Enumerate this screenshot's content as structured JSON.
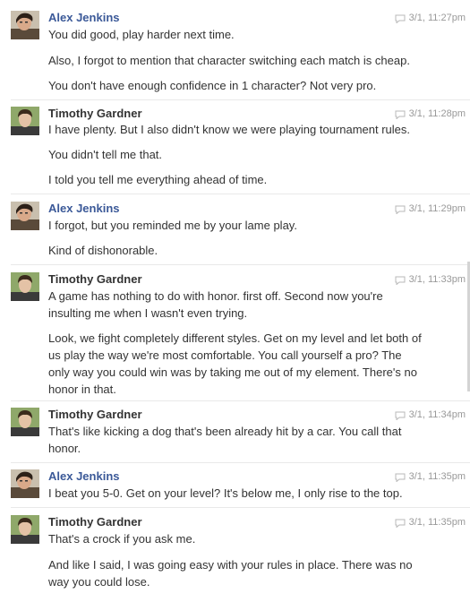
{
  "groups": [
    {
      "author": "Alex Jenkins",
      "time": "3/1, 11:27pm",
      "lines": [
        "You did good, play harder next time.",
        "Also, I forgot to mention that character switching each match is cheap.",
        "You don't have enough confidence in 1 character? Not very pro."
      ]
    },
    {
      "author": "Timothy Gardner",
      "time": "3/1, 11:28pm",
      "lines": [
        "I have plenty. But I also didn't know we were playing tournament rules.",
        "You didn't tell me that.",
        "I told you tell me everything ahead of time."
      ]
    },
    {
      "author": "Alex Jenkins",
      "time": "3/1, 11:29pm",
      "lines": [
        "I forgot, but you reminded me by your lame play.",
        "Kind of dishonorable."
      ]
    },
    {
      "author": "Timothy Gardner",
      "time": "3/1, 11:33pm",
      "lines": [
        "A game has nothing to do with honor. first off. Second now you're insulting me when I wasn't even trying.",
        "Look, we fight completely different styles. Get on my level and let both of us play the way we're most comfortable. You call yourself a pro? The only way you could win was by taking me out of my element. There's no honor in that."
      ]
    },
    {
      "author": "Timothy Gardner",
      "time": "3/1, 11:34pm",
      "lines": [
        "That's like kicking a dog that's been already hit by a car. You call that honor."
      ]
    },
    {
      "author": "Alex Jenkins",
      "time": "3/1, 11:35pm",
      "lines": [
        "I beat you 5-0. Get on your level? It's below me, I only rise to the top."
      ]
    },
    {
      "author": "Timothy Gardner",
      "time": "3/1, 11:35pm",
      "lines": [
        "That's a crock if you ask me.",
        "And like I said, I was going easy with your rules in place. There was no way you could lose."
      ]
    }
  ]
}
